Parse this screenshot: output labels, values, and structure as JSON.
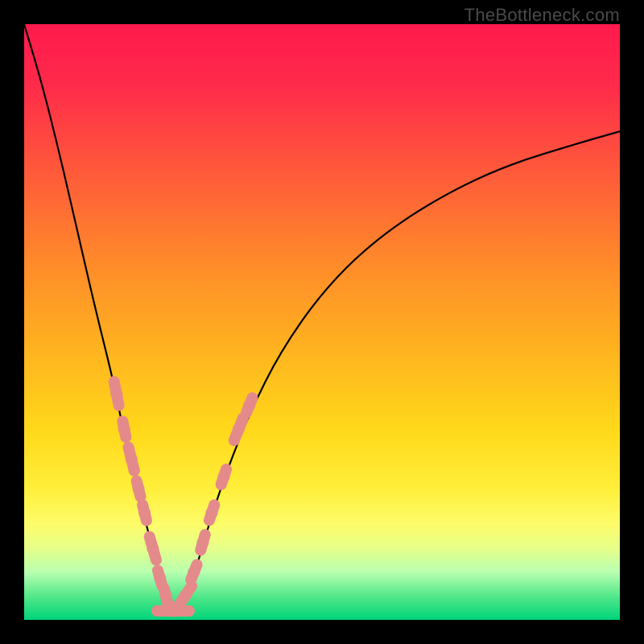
{
  "attribution": "TheBottleneck.com",
  "colors": {
    "frame": "#000000",
    "gradient_top": "#ff1a4d",
    "gradient_bottom": "#00d47a",
    "curve": "#000000",
    "markers": "#e58a8a",
    "attribution_text": "#4a4a4a"
  },
  "chart_data": {
    "type": "line",
    "title": "",
    "xlabel": "",
    "ylabel": "",
    "xlim": [
      0,
      100
    ],
    "ylim": [
      0,
      100
    ],
    "grid": false,
    "legend": false,
    "notes": "V-shaped bottleneck curve plotted over a vertical red-to-green gradient. The minimum (green zone) is around x≈25. No axis ticks or labels are shown; y-values are estimated from the plot area height (0=bottom green strip, 100=top red).",
    "series": [
      {
        "name": "left_branch",
        "x": [
          0,
          3,
          6,
          9,
          12,
          15,
          17,
          19,
          21,
          23,
          24,
          25
        ],
        "y": [
          100,
          90,
          78,
          65,
          52,
          40,
          30,
          22,
          14,
          7,
          3,
          1
        ]
      },
      {
        "name": "right_branch",
        "x": [
          25,
          27,
          29,
          31,
          34,
          38,
          43,
          50,
          58,
          68,
          80,
          93,
          100
        ],
        "y": [
          1,
          4,
          9,
          16,
          25,
          35,
          45,
          55,
          63,
          70,
          76,
          80,
          82
        ]
      }
    ],
    "markers": [
      {
        "branch": "left",
        "x": 15.5,
        "y": 38,
        "len": 3
      },
      {
        "branch": "left",
        "x": 16.8,
        "y": 32,
        "len": 2
      },
      {
        "branch": "left",
        "x": 18.0,
        "y": 27,
        "len": 3
      },
      {
        "branch": "left",
        "x": 19.2,
        "y": 22,
        "len": 2
      },
      {
        "branch": "left",
        "x": 20.2,
        "y": 18,
        "len": 2
      },
      {
        "branch": "left",
        "x": 21.6,
        "y": 12,
        "len": 3
      },
      {
        "branch": "left",
        "x": 22.8,
        "y": 7,
        "len": 2
      },
      {
        "branch": "left",
        "x": 23.8,
        "y": 4,
        "len": 2
      },
      {
        "branch": "min",
        "x": 25.0,
        "y": 1.5,
        "len": 4
      },
      {
        "branch": "right",
        "x": 27.0,
        "y": 4,
        "len": 3
      },
      {
        "branch": "right",
        "x": 28.5,
        "y": 8,
        "len": 2
      },
      {
        "branch": "right",
        "x": 30.0,
        "y": 13,
        "len": 2
      },
      {
        "branch": "right",
        "x": 31.5,
        "y": 18,
        "len": 2
      },
      {
        "branch": "right",
        "x": 33.5,
        "y": 24,
        "len": 2
      },
      {
        "branch": "right",
        "x": 36.0,
        "y": 32,
        "len": 3
      },
      {
        "branch": "right",
        "x": 37.8,
        "y": 36,
        "len": 2
      }
    ]
  }
}
